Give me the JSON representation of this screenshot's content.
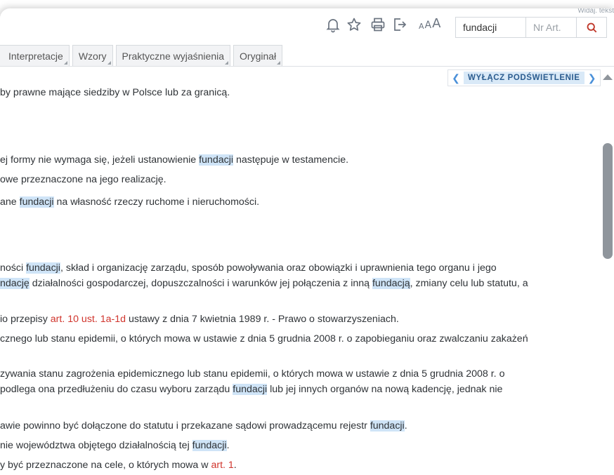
{
  "header": {
    "corner_text": "Widaj. tekst"
  },
  "toolbar": {
    "font_sizes": [
      "A",
      "A",
      "A"
    ],
    "search_value": "fundacji",
    "article_placeholder": "Nr Art."
  },
  "tabs": [
    {
      "label": "Interpretacje"
    },
    {
      "label": "Wzory"
    },
    {
      "label": "Praktyczne wyjaśnienia"
    },
    {
      "label": "Oryginał"
    }
  ],
  "highlight_nav": {
    "label": "WYŁĄCZ PODŚWIETLENIE"
  },
  "content": {
    "l1": "by prawne mające siedziby w Polsce lub za granicą.",
    "l2a": "ej formy nie wymaga się, jeżeli ustanowienie ",
    "l2b": "fundacji",
    "l2c": " następuje w testamencie.",
    "l3": "owe przeznaczone na jego realizację.",
    "l4a": "ane ",
    "l4b": "fundacji",
    "l4c": " na własność rzeczy ruchome i nieruchomości.",
    "l5a": "ności ",
    "l5b": "fundacji",
    "l5c": ", skład i organizację zarządu, sposób powoływania oraz obowiązki i uprawnienia tego organu i jego",
    "l6a": "ndację",
    "l6b": " działalności gospodarczej, dopuszczalności i warunków jej połączenia z inną ",
    "l6c": "fundacją",
    "l6d": ", zmiany celu lub statutu, a",
    "l7a": "io przepisy ",
    "l7b": "art. 10 ust. 1a-1d",
    "l7c": " ustawy z dnia 7 kwietnia 1989 r. - Prawo o stowarzyszeniach.",
    "l8": "cznego lub stanu epidemii, o których mowa w ustawie z dnia 5 grudnia 2008 r. o zapobieganiu oraz zwalczaniu zakażeń",
    "l9": "zywania stanu zagrożenia epidemicznego lub stanu epidemii, o których mowa w ustawie z dnia 5 grudnia 2008 r. o",
    "l10a": "podlega ona przedłużeniu do czasu wyboru zarządu ",
    "l10b": "fundacji",
    "l10c": " lub jej innych organów na nową kadencję, jednak nie",
    "l11a": "awie powinno być dołączone do statutu i przekazane sądowi prowadzącemu rejestr ",
    "l11b": "fundacji",
    "l11c": ".",
    "l12a": "nie województwa objętego działalnością tej ",
    "l12b": "fundacji",
    "l12c": ".",
    "l13a": "y być przeznaczone na cele, o których mowa w ",
    "l13b": "art. 1",
    "l13c": "."
  }
}
